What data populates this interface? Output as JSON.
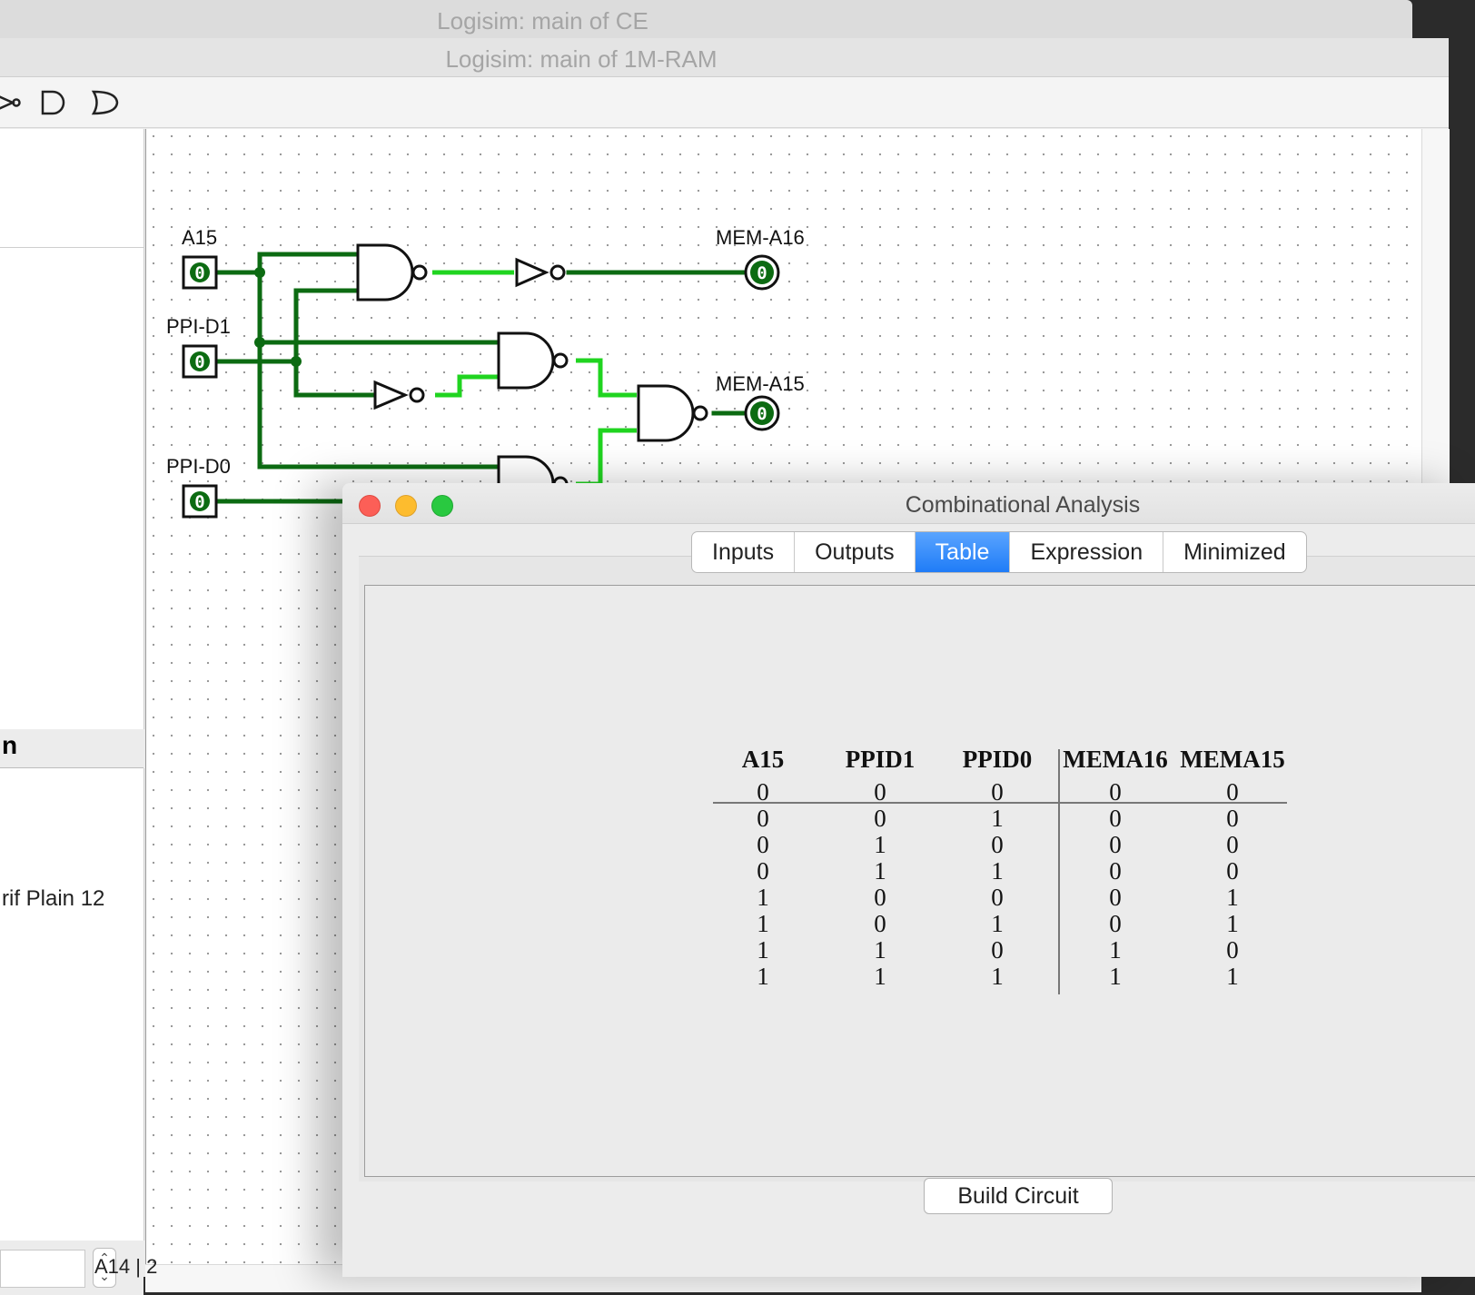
{
  "windows": {
    "back_title": "Logisim: main of CE",
    "main_title": "Logisim: main of 1M-RAM"
  },
  "left_pane": {
    "section_header": "n",
    "font_attr": "rif Plain 12"
  },
  "bottom": {
    "label": "A14 | 2"
  },
  "circuit": {
    "inputs": [
      {
        "label": "A15",
        "value": "0"
      },
      {
        "label": "PPI-D1",
        "value": "0"
      },
      {
        "label": "PPI-D0",
        "value": "0"
      }
    ],
    "outputs": [
      {
        "label": "MEM-A16",
        "value": "0"
      },
      {
        "label": "MEM-A15",
        "value": "0"
      }
    ]
  },
  "colors": {
    "wire_dark": "#0c6b12",
    "wire_bright": "#20d420",
    "accent_tab": "#1f7cf7",
    "close": "#fc5f57",
    "minimize": "#fdbc2e",
    "zoom": "#29c940"
  },
  "analysis": {
    "title": "Combinational Analysis",
    "tabs": [
      "Inputs",
      "Outputs",
      "Table",
      "Expression",
      "Minimized"
    ],
    "active_tab": "Table",
    "build_label": "Build Circuit",
    "table": {
      "input_headers": [
        "A15",
        "PPID1",
        "PPID0"
      ],
      "output_headers": [
        "MEMA16",
        "MEMA15"
      ],
      "rows": [
        [
          "0",
          "0",
          "0",
          "0",
          "0"
        ],
        [
          "0",
          "0",
          "1",
          "0",
          "0"
        ],
        [
          "0",
          "1",
          "0",
          "0",
          "0"
        ],
        [
          "0",
          "1",
          "1",
          "0",
          "0"
        ],
        [
          "1",
          "0",
          "0",
          "0",
          "1"
        ],
        [
          "1",
          "0",
          "1",
          "0",
          "1"
        ],
        [
          "1",
          "1",
          "0",
          "1",
          "0"
        ],
        [
          "1",
          "1",
          "1",
          "1",
          "1"
        ]
      ]
    }
  }
}
